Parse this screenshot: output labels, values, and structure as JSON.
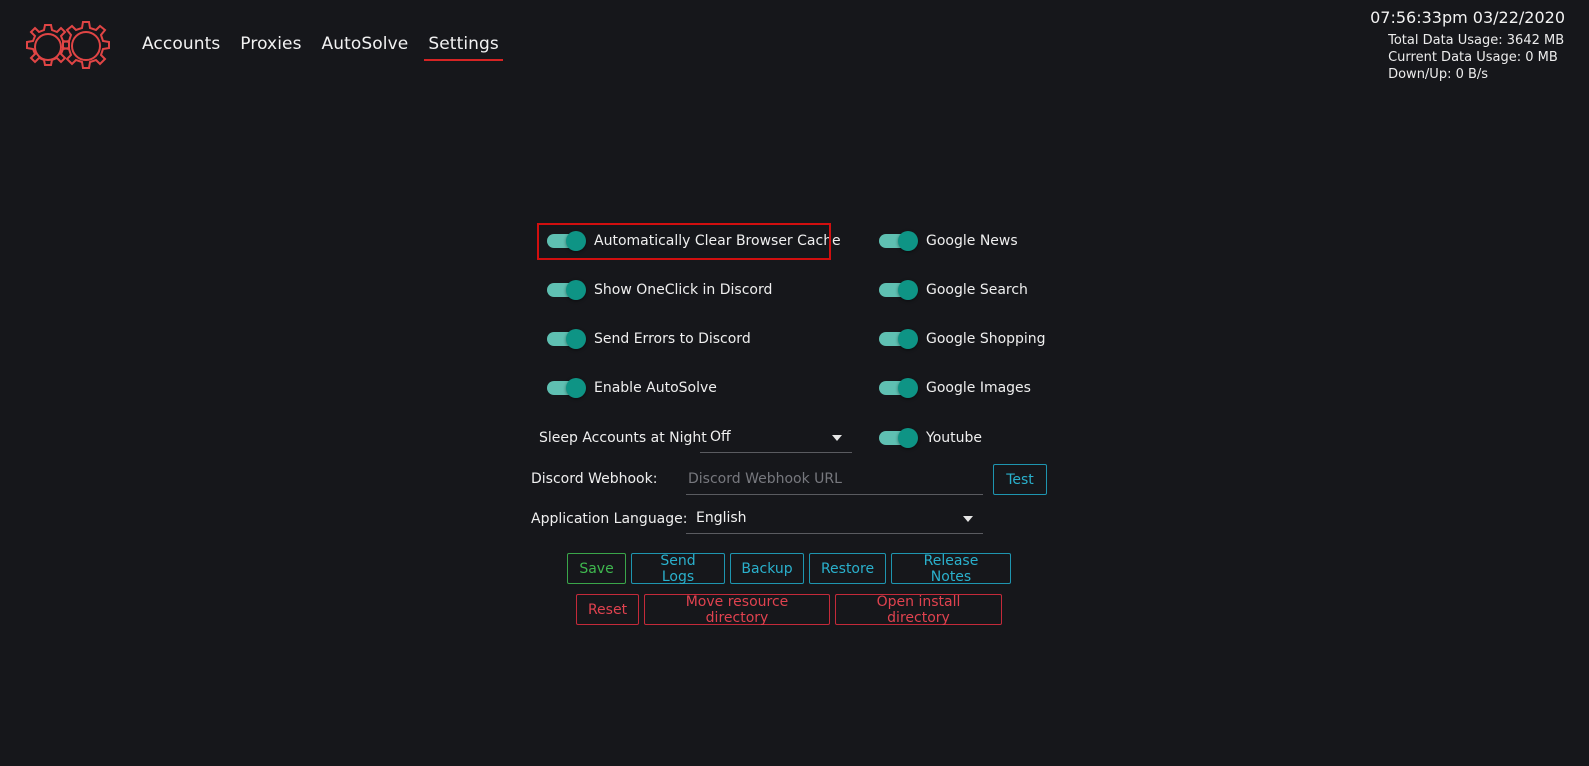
{
  "nav": {
    "items": [
      {
        "label": "Accounts",
        "active": false
      },
      {
        "label": "Proxies",
        "active": false
      },
      {
        "label": "AutoSolve",
        "active": false
      },
      {
        "label": "Settings",
        "active": true
      }
    ]
  },
  "status": {
    "clock": "07:56:33pm 03/22/2020",
    "total_data": "Total Data Usage:  3642 MB",
    "current_data": "Current Data Usage: 0 MB",
    "down_up": "Down/Up: 0 B/s"
  },
  "toggles_left": [
    {
      "label": "Automatically Clear Browser Cache",
      "on": true
    },
    {
      "label": "Show OneClick in Discord",
      "on": true
    },
    {
      "label": "Send Errors to Discord",
      "on": true
    },
    {
      "label": "Enable AutoSolve",
      "on": true
    }
  ],
  "toggles_right": [
    {
      "label": "Google News",
      "on": true
    },
    {
      "label": "Google Search",
      "on": true
    },
    {
      "label": "Google Shopping",
      "on": true
    },
    {
      "label": "Google Images",
      "on": true
    },
    {
      "label": "Youtube",
      "on": true
    }
  ],
  "sleep": {
    "label": "Sleep Accounts at Night",
    "value": "Off"
  },
  "webhook": {
    "label": "Discord Webhook:",
    "placeholder": "Discord Webhook URL",
    "value": "",
    "test_label": "Test"
  },
  "language": {
    "label": "Application Language:",
    "value": "English"
  },
  "buttons_row1": {
    "save": "Save",
    "send_logs": "Send Logs",
    "backup": "Backup",
    "restore": "Restore",
    "release_notes": "Release Notes"
  },
  "buttons_row2": {
    "reset": "Reset",
    "move_resource": "Move resource directory",
    "open_install": "Open install directory"
  },
  "colors": {
    "background": "#16171b",
    "accent_red": "#d62424",
    "toggle_knob": "#0e9485",
    "toggle_track": "#5fc0b2",
    "button_green": "#3fb84f",
    "button_teal": "#2ab0cc",
    "button_red": "#e0424f"
  }
}
